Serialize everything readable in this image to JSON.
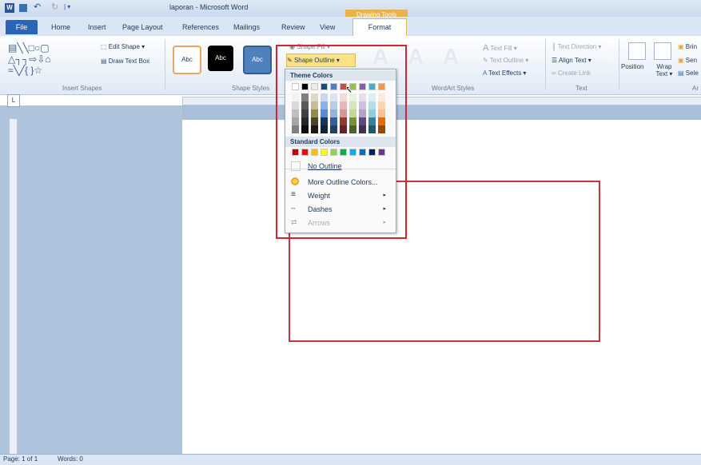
{
  "window": {
    "title": "laporan - Microsoft Word",
    "contextual_tab": "Drawing Tools"
  },
  "tabs": [
    "File",
    "Home",
    "Insert",
    "Page Layout",
    "References",
    "Mailings",
    "Review",
    "View",
    "Format"
  ],
  "ribbon": {
    "insert_shapes": {
      "label": "Insert Shapes",
      "edit_shape": "Edit Shape ▾",
      "draw_text_box": "Draw Text Box"
    },
    "shape_styles": {
      "label": "Shape Styles",
      "samples": [
        "Abc",
        "Abc",
        "Abc"
      ],
      "shape_fill": "Shape Fill ▾",
      "shape_outline": "Shape Outline ▾"
    },
    "wordart_styles": {
      "label": "WordArt Styles",
      "text_fill": "Text Fill ▾",
      "text_outline": "Text Outline ▾",
      "text_effects": "Text Effects ▾"
    },
    "text": {
      "label": "Text",
      "text_direction": "Text Direction ▾",
      "align_text": "Align Text ▾",
      "create_link": "Create Link"
    },
    "arrange": {
      "label": "Ar",
      "position": "Position",
      "wrap_text": "Wrap Text ▾",
      "bring": "Brin",
      "send": "Sen",
      "select": "Sele"
    }
  },
  "outline_menu": {
    "theme_colors_heading": "Theme Colors",
    "standard_colors_heading": "Standard Colors",
    "theme_top_row": [
      "#ffffff",
      "#000000",
      "#eeece1",
      "#1f497d",
      "#4f81bd",
      "#c0504d",
      "#9bbb59",
      "#8064a2",
      "#4bacc6",
      "#f79646"
    ],
    "theme_columns": [
      [
        "#f2f2f2",
        "#d9d9d9",
        "#bfbfbf",
        "#a6a6a6",
        "#808080"
      ],
      [
        "#7f7f7f",
        "#595959",
        "#404040",
        "#262626",
        "#0d0d0d"
      ],
      [
        "#ddd9c3",
        "#c4bd97",
        "#948a54",
        "#4a452a",
        "#1d1b10"
      ],
      [
        "#c6d9f0",
        "#8db3e2",
        "#548dd4",
        "#17365d",
        "#0f243e"
      ],
      [
        "#dbe5f1",
        "#b8cce4",
        "#95b3d7",
        "#366092",
        "#244061"
      ],
      [
        "#f2dcdb",
        "#e5b9b7",
        "#d99694",
        "#953734",
        "#632423"
      ],
      [
        "#ebf1dd",
        "#d7e3bc",
        "#c3d69b",
        "#76923c",
        "#4f6128"
      ],
      [
        "#e5e0ec",
        "#ccc1d9",
        "#b2a2c7",
        "#5f497a",
        "#3f3151"
      ],
      [
        "#dbeef3",
        "#b7dde8",
        "#92cddc",
        "#31859b",
        "#205867"
      ],
      [
        "#fdeada",
        "#fbd5b5",
        "#fac08f",
        "#e36c09",
        "#974806"
      ]
    ],
    "standard_colors": [
      "#c00000",
      "#ff0000",
      "#ffc000",
      "#ffff00",
      "#92d050",
      "#00b050",
      "#00b0f0",
      "#0070c0",
      "#002060",
      "#7030a0"
    ],
    "no_outline": "No Outline",
    "more_colors": "More Outline Colors...",
    "weight": "Weight",
    "dashes": "Dashes",
    "arrows": "Arrows"
  },
  "status": {
    "page": "Page: 1 of 1",
    "words": "Words: 0"
  },
  "colors": {
    "shape_border": "#c0373e",
    "highlight": "#d9232b",
    "accent": "#2a64b6"
  }
}
